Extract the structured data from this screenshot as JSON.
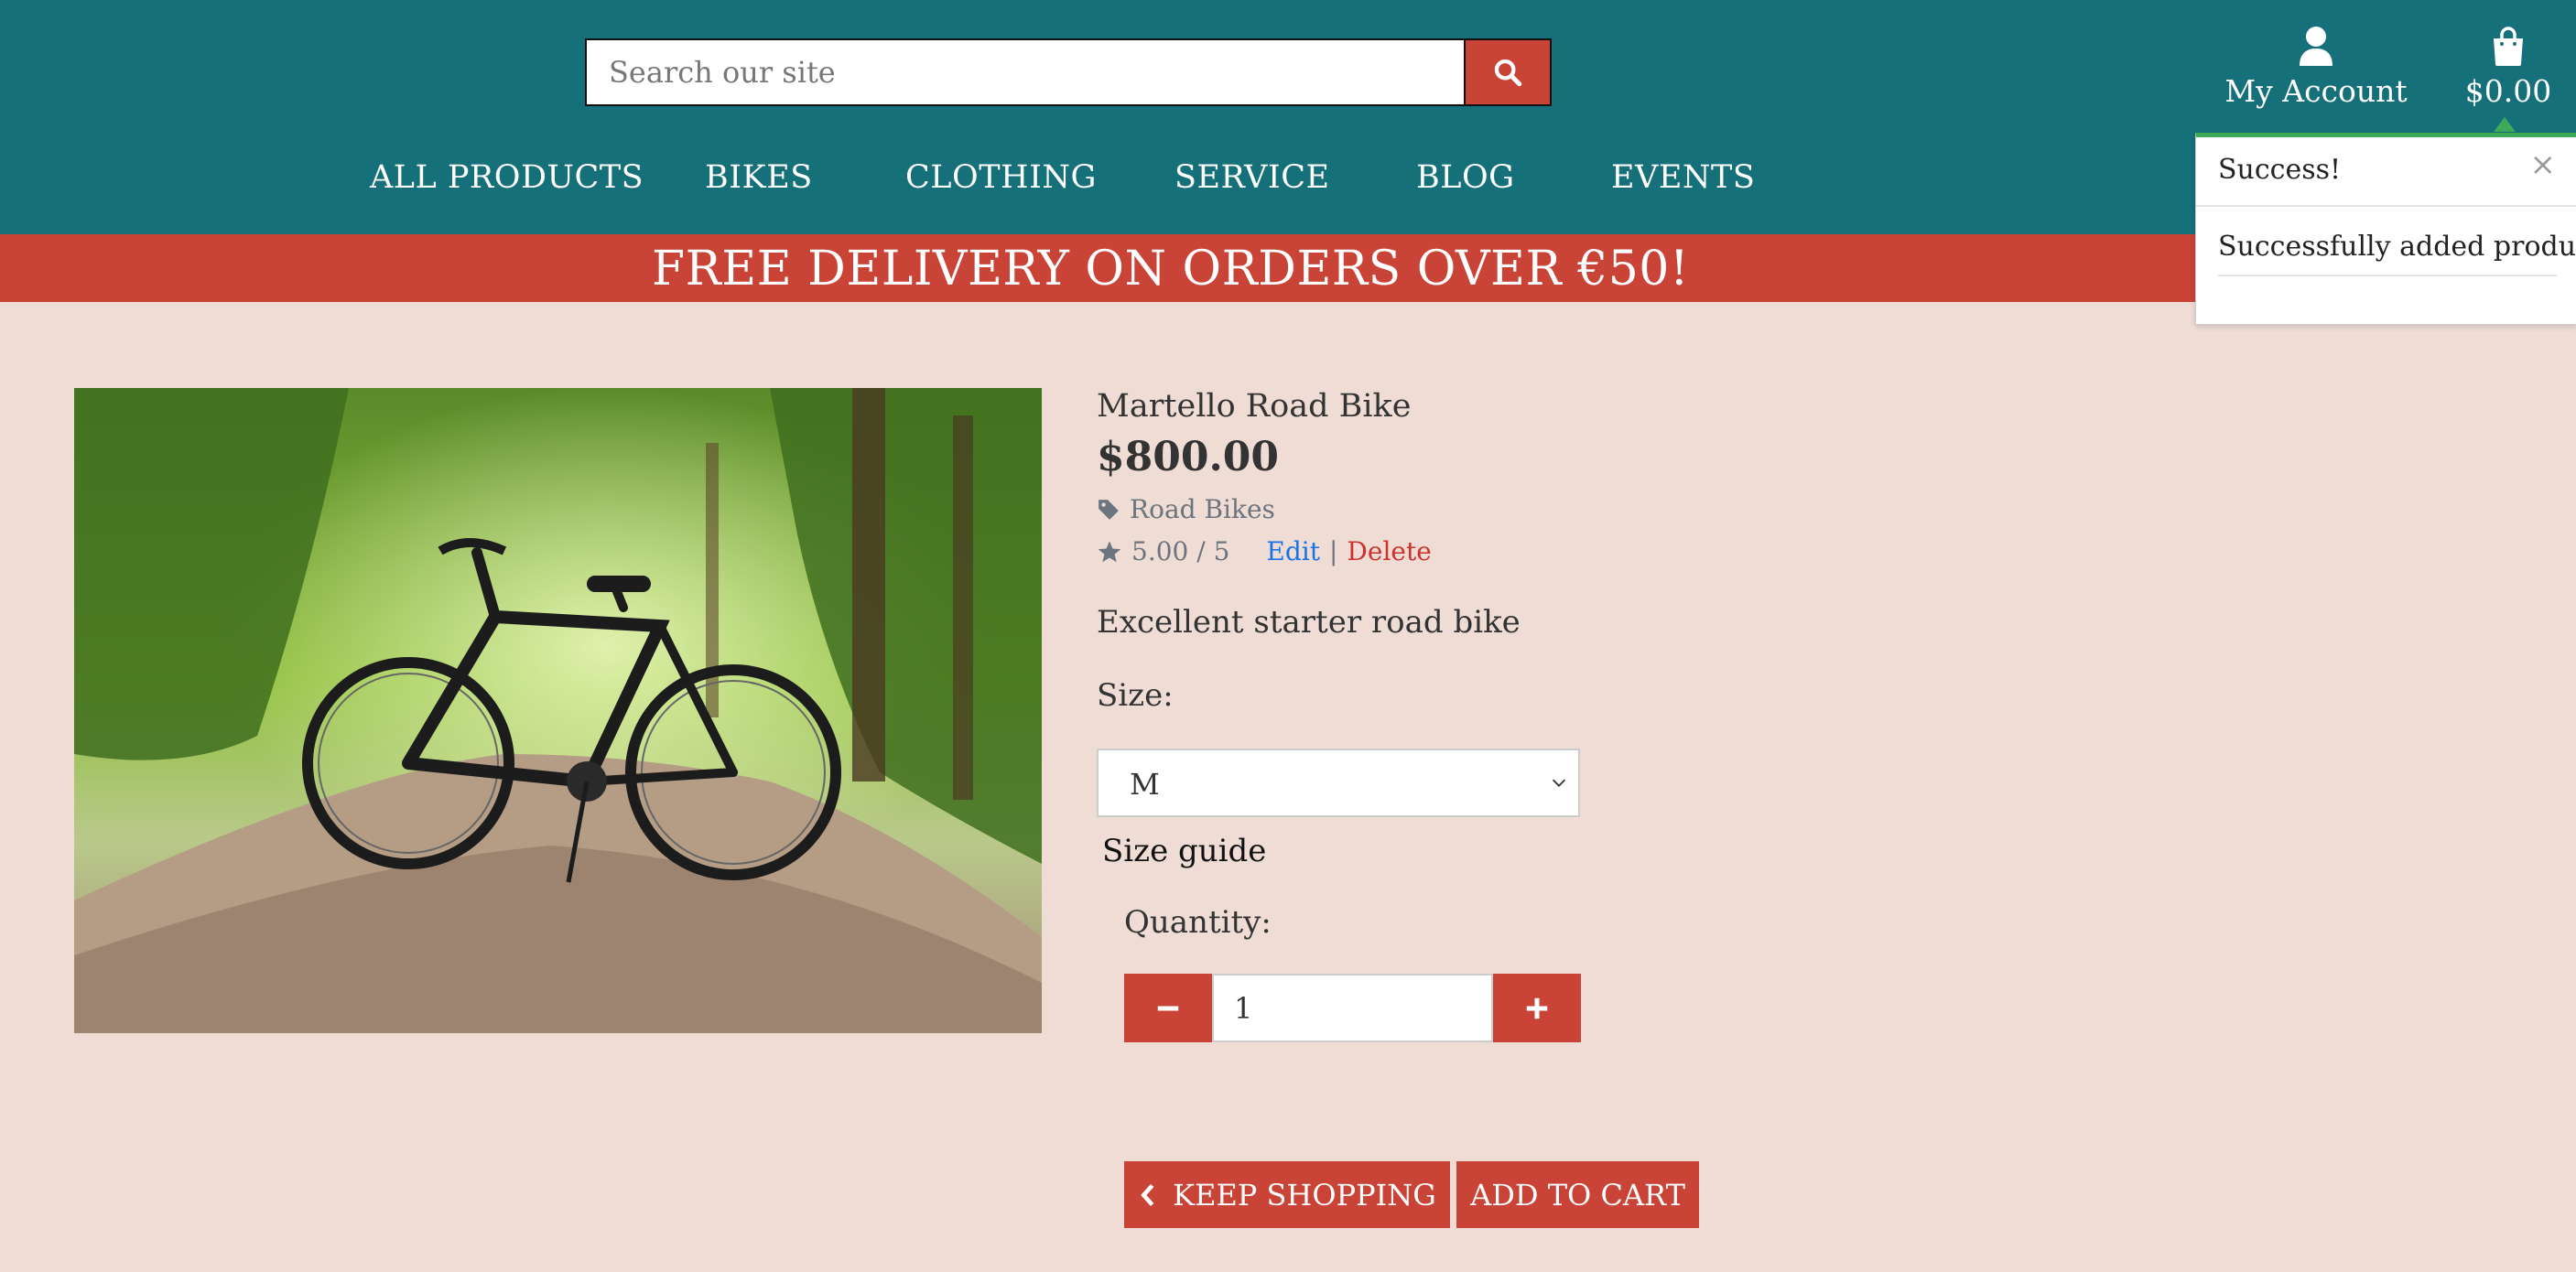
{
  "search": {
    "placeholder": "Search our site",
    "icon": "search-icon"
  },
  "account": {
    "label": "My Account",
    "icon": "user-icon"
  },
  "cart": {
    "total": "$0.00",
    "icon": "shopping-bag-icon"
  },
  "nav": [
    {
      "label": "ALL PRODUCTS"
    },
    {
      "label": "BIKES"
    },
    {
      "label": "CLOTHING"
    },
    {
      "label": "SERVICE"
    },
    {
      "label": "BLOG"
    },
    {
      "label": "EVENTS"
    }
  ],
  "banner": {
    "text": "FREE DELIVERY ON ORDERS OVER €50!"
  },
  "toast": {
    "title": "Success!",
    "message": "Successfully added product!",
    "close": "×",
    "accent_color": "#3daa5a"
  },
  "product": {
    "name": "Martello Road Bike",
    "price": "$800.00",
    "category": "Road Bikes",
    "rating": "5.00 / 5",
    "edit_label": "Edit",
    "separator": "|",
    "delete_label": "Delete",
    "description": "Excellent starter road bike",
    "image": "bicycle-on-forest-path"
  },
  "size": {
    "label": "Size:",
    "selected": "M",
    "guide_label": "Size guide"
  },
  "quantity": {
    "label": "Quantity:",
    "value": "1"
  },
  "actions": {
    "keep_shopping": "KEEP SHOPPING",
    "add_to_cart": "ADD TO CART"
  },
  "colors": {
    "header": "#167079",
    "accent": "#c94436",
    "background": "#eedcd5"
  }
}
